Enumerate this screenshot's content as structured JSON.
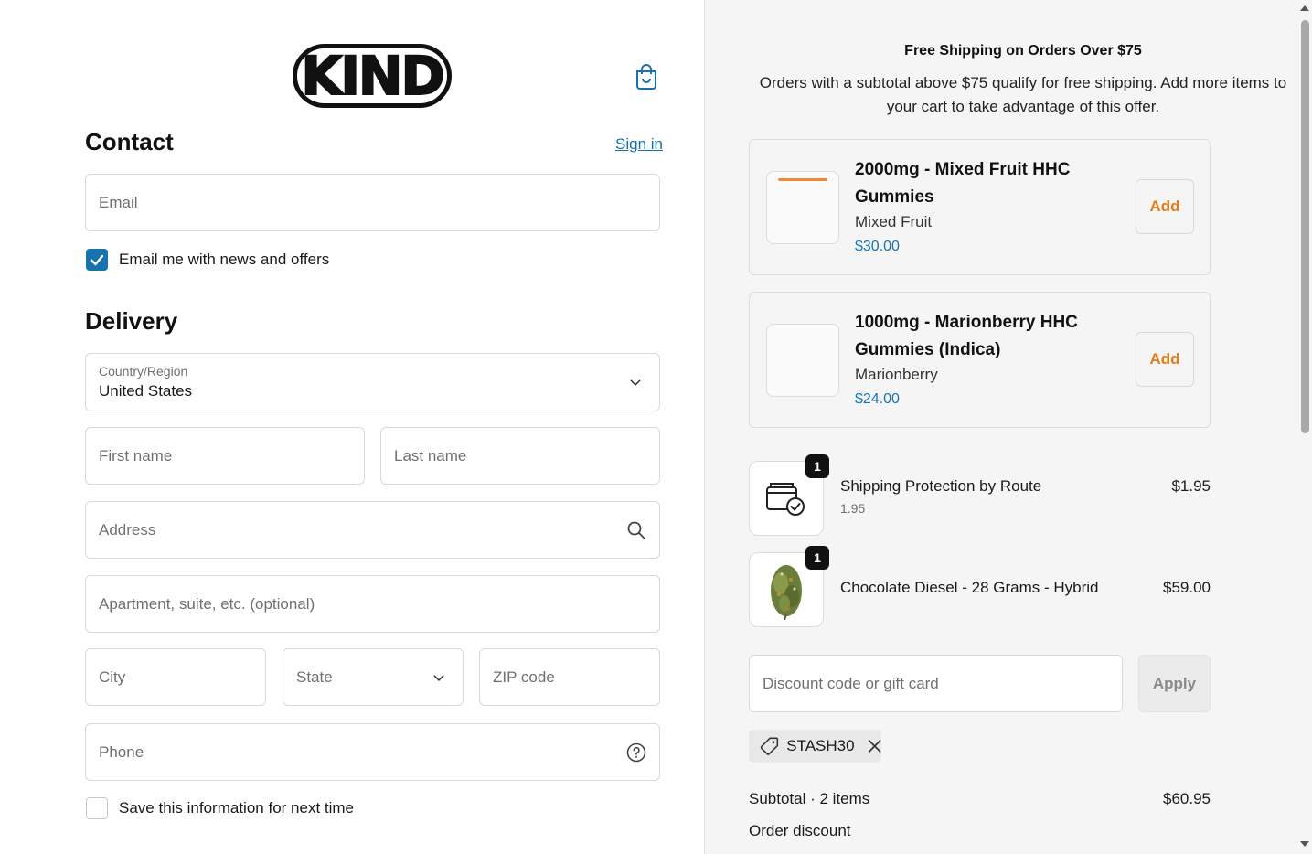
{
  "header": {
    "logo_text": "KIND",
    "cart_icon": "shopping-bag-icon"
  },
  "contact": {
    "heading": "Contact",
    "sign_in": "Sign in",
    "email_placeholder": "Email",
    "news_checkbox_label": "Email me with news and offers",
    "news_checked": true
  },
  "delivery": {
    "heading": "Delivery",
    "country_label": "Country/Region",
    "country_value": "United States",
    "first_name_placeholder": "First name",
    "last_name_placeholder": "Last name",
    "address_placeholder": "Address",
    "apartment_placeholder": "Apartment, suite, etc. (optional)",
    "city_placeholder": "City",
    "state_placeholder": "State",
    "zip_placeholder": "ZIP code",
    "phone_placeholder": "Phone",
    "save_info_label": "Save this information for next time",
    "save_info_checked": false
  },
  "promo": {
    "title": "Free Shipping on Orders Over $75",
    "description": "Orders with a subtotal above $75 qualify for free shipping. Add more items to your cart to take advantage of this offer."
  },
  "upsells": [
    {
      "name": "2000mg - Mixed Fruit HHC Gummies",
      "variant": "Mixed Fruit",
      "price": "$30.00",
      "button": "Add"
    },
    {
      "name": "1000mg - Marionberry HHC Gummies (Indica)",
      "variant": "Marionberry",
      "price": "$24.00",
      "button": "Add"
    }
  ],
  "line_items": [
    {
      "name": "Shipping Protection by Route",
      "subtitle": "1.95",
      "price": "$1.95",
      "quantity": "1",
      "icon": "package-check-icon"
    },
    {
      "name": "Chocolate Diesel - 28 Grams - Hybrid",
      "subtitle": "",
      "price": "$59.00",
      "quantity": "1",
      "icon": "product-image"
    }
  ],
  "discount": {
    "placeholder": "Discount code or gift card",
    "apply": "Apply",
    "applied_code": "STASH30"
  },
  "summary": {
    "subtotal_label": "Subtotal · 2 items",
    "subtotal_value": "$60.95",
    "order_discount_label": "Order discount"
  },
  "colors": {
    "accent": "#1773b0",
    "add_button_text": "#e67a14",
    "summary_bg": "#f5f5f5"
  }
}
